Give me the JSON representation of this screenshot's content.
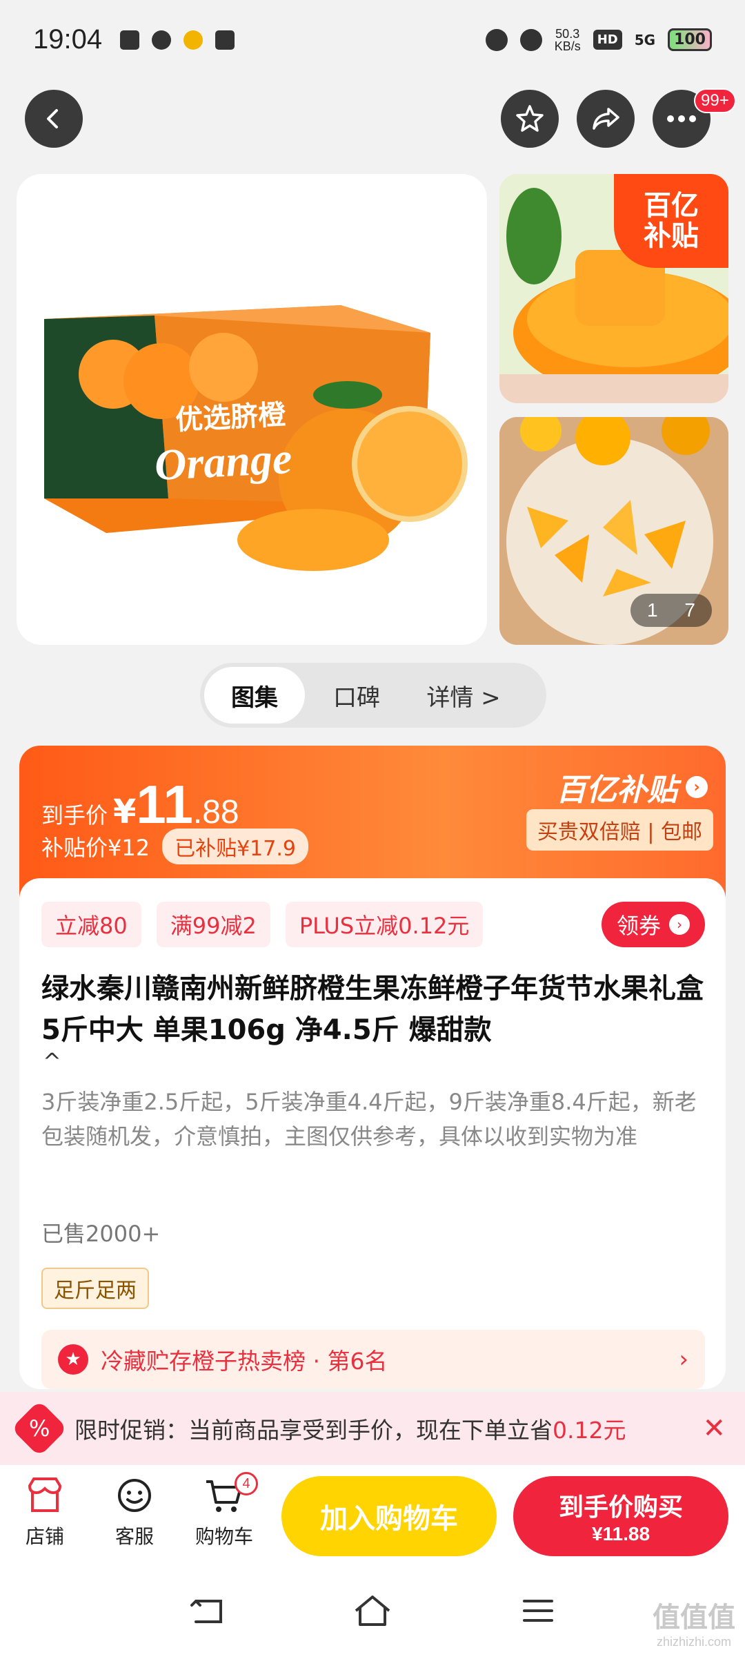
{
  "status_bar": {
    "time": "19:04",
    "net_speed": "50.3",
    "net_unit": "KB/s",
    "hd": "HD",
    "signal": "5G",
    "battery": "100"
  },
  "header": {
    "more_badge": "99+"
  },
  "gallery": {
    "box_brand_text": "优选脐橙",
    "box_orange_text": "Orange",
    "subsidy_line1": "百亿",
    "subsidy_line2": "补贴",
    "counter_current": "1",
    "counter_total": "7"
  },
  "tabs": [
    {
      "label": "图集"
    },
    {
      "label": "口碑"
    },
    {
      "label": "详情 >"
    }
  ],
  "price": {
    "label": "到手价",
    "yen": "¥",
    "integer": "11",
    "decimal": ".88",
    "subsidy_price": "补贴价¥12",
    "subsidized": "已补贴¥17.9",
    "brand": "百亿补贴",
    "guarantee": "买贵双倍赔 | 包邮"
  },
  "product": {
    "coupons": [
      "立减80",
      "满99减2",
      "PLUS立减0.12元"
    ],
    "get_coupon": "领券",
    "title": "绿水秦川赣南州新鲜脐橙生果冻鲜橙子年货节水果礼盒 5斤中大 单果106g 净4.5斤 爆甜款",
    "description": "3斤装净重2.5斤起，5斤装净重4.4斤起，9斤装净重8.4斤起，新老包装随机发，介意慎拍，主图仅供参考，具体以收到实物为准",
    "sold": "已售2000+",
    "full_weight": "足斤足两",
    "rank": "冷藏贮存橙子热卖榜 · 第6名"
  },
  "promo": {
    "text": "限时促销：当前商品享受到手价，现在下单立省",
    "save": "0.12元"
  },
  "bottom_nav": {
    "store": "店铺",
    "service": "客服",
    "cart": "购物车",
    "cart_count": "4",
    "add_cart": "加入购物车",
    "buy_line1": "到手价购买",
    "buy_line2": "¥11.88"
  },
  "watermark": {
    "line1": "值值值",
    "line2": "zhizhizhi.com"
  },
  "colors": {
    "accent_red": "#f0243c",
    "accent_orange": "#ff5a17",
    "cart_yellow": "#ffd400"
  }
}
